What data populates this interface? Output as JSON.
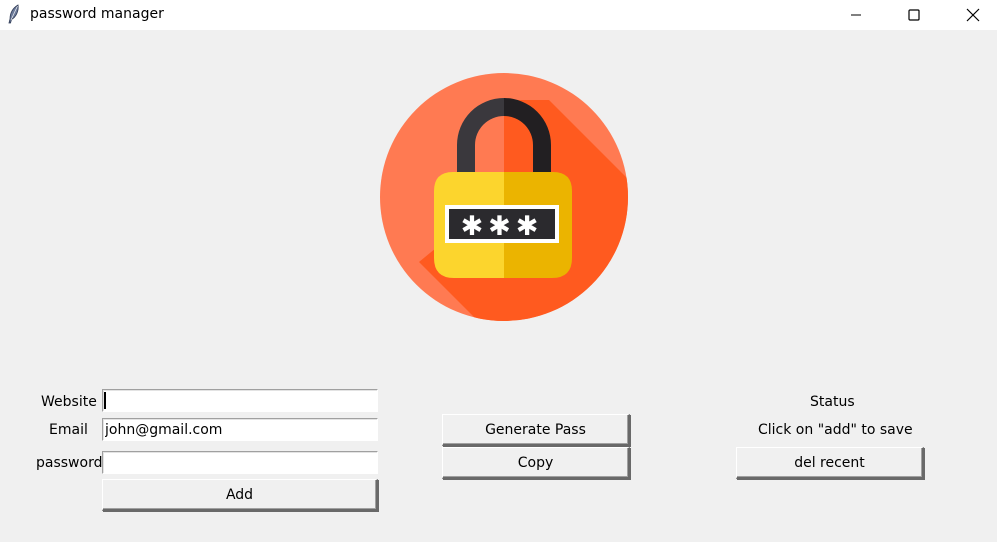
{
  "window": {
    "title": "password manager",
    "title_icon": "feather-icon",
    "controls": {
      "minimize_icon": "minimize-icon",
      "maximize_icon": "maximize-icon",
      "close_icon": "close-icon"
    }
  },
  "logo": {
    "icon": "padlock-icon",
    "password_mask": "✱✱✱",
    "colors": {
      "circle": "#ff7a52",
      "shadow": "#ff5a1f",
      "shackle": "#3a383d",
      "body_left": "#fcd52d",
      "body_right": "#ebb400",
      "field": "#2b2a2e"
    }
  },
  "form": {
    "website_label": "Website",
    "email_label": "Email",
    "password_label": "password",
    "website_value": "",
    "email_value": "john@gmail.com",
    "password_value": "",
    "add_button": "Add"
  },
  "actions": {
    "generate_button": "Generate Pass",
    "copy_button": "Copy"
  },
  "status": {
    "title": "Status",
    "message": "Click on \"add\" to save",
    "del_button": "del recent"
  }
}
